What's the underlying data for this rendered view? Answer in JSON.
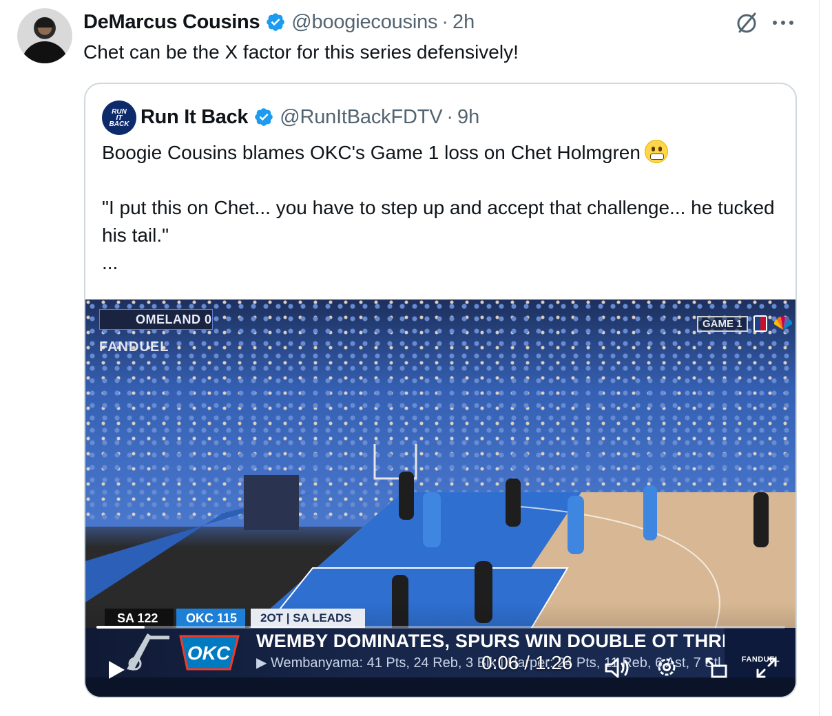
{
  "post": {
    "display_name": "DeMarcus Cousins",
    "handle": "@boogiecousins",
    "separator": "·",
    "time": "2h",
    "text": "Chet can be the X factor for this series defensively!"
  },
  "quote": {
    "display_name": "Run It Back",
    "handle": "@RunItBackFDTV",
    "separator": "·",
    "time": "9h",
    "avatar_text": [
      "RUN",
      "IT",
      "BACK"
    ],
    "line1": "Boogie Cousins blames OKC's Game 1 loss on Chet Holmgren",
    "line2": "\"I put this on Chet... you have to step up and accept that challenge... he tucked his tail.\"",
    "ellipsis": "..."
  },
  "video": {
    "fanduel_ticker": "OMELAND  0",
    "fanduel_word": "FANDUEL",
    "game_badge": "GAME 1",
    "score": {
      "sa": "SA  122",
      "okc": "OKC  115",
      "info": "2OT | SA LEADS 1-0"
    },
    "headline": "WEMBY DOMINATES, SPURS WIN DOUBLE OT THRILLER",
    "subline": "▶ Wembanyama: 41 Pts, 24 Reb, 3 Blk | Harper: 24 Pts, 11 Reb, 6 Ast, 7 Stl",
    "corner_brand": "FANDUEL",
    "progress_fraction": 0.07,
    "current_time": "0:06",
    "duration": "1:26",
    "time_sep": " / "
  },
  "colors": {
    "verified": "#1d9bf0",
    "text_primary": "#0f1419",
    "text_secondary": "#536471",
    "card_border": "#cfd9de"
  },
  "icons": [
    "verified-badge-icon",
    "grok-icon",
    "more-icon",
    "play-icon",
    "volume-icon",
    "settings-icon",
    "picture-in-picture-icon",
    "fullscreen-icon"
  ]
}
